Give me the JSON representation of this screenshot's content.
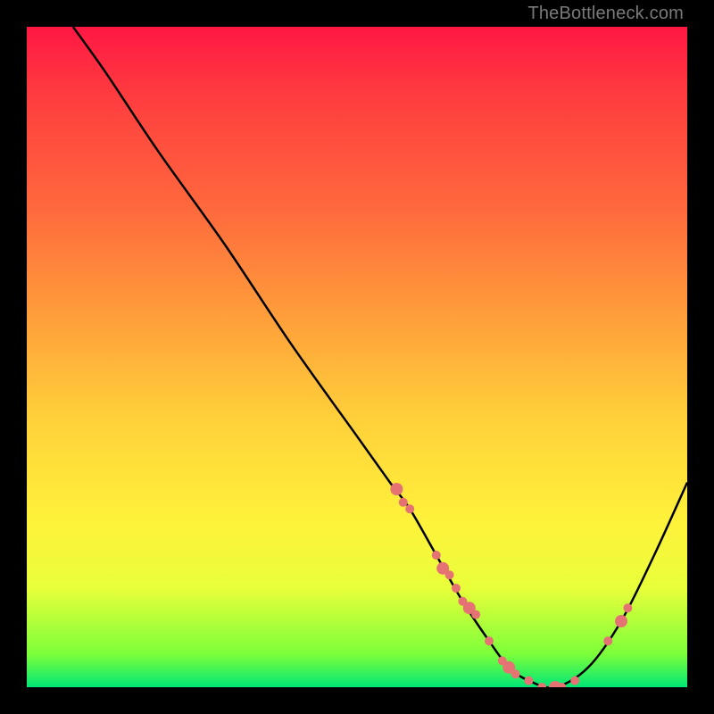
{
  "watermark": {
    "text": "TheBottleneck.com"
  },
  "chart_data": {
    "type": "line",
    "title": "",
    "xlabel": "",
    "ylabel": "",
    "xlim": [
      0,
      100
    ],
    "ylim": [
      0,
      100
    ],
    "grid": false,
    "legend": false,
    "curve": {
      "name": "bottleneck-curve",
      "x": [
        7,
        12,
        20,
        30,
        40,
        50,
        55,
        58,
        62,
        66,
        70,
        73,
        76,
        80,
        85,
        90,
        95,
        100
      ],
      "y": [
        100,
        93,
        81,
        67,
        52,
        38,
        31,
        27,
        20,
        13,
        7,
        3,
        1,
        0,
        3,
        10,
        20,
        31
      ]
    },
    "scatter_on_curve": {
      "name": "markers",
      "color": "#e57373",
      "x": [
        56,
        57,
        58,
        62,
        63,
        64,
        65,
        66,
        67,
        68,
        70,
        72,
        73,
        74,
        76,
        78,
        80,
        81,
        83,
        88,
        90,
        91
      ],
      "y": [
        30,
        28,
        27,
        20,
        18,
        17,
        15,
        13,
        12,
        11,
        7,
        4,
        3,
        2,
        1,
        0,
        0,
        0,
        1,
        7,
        10,
        12
      ]
    }
  }
}
